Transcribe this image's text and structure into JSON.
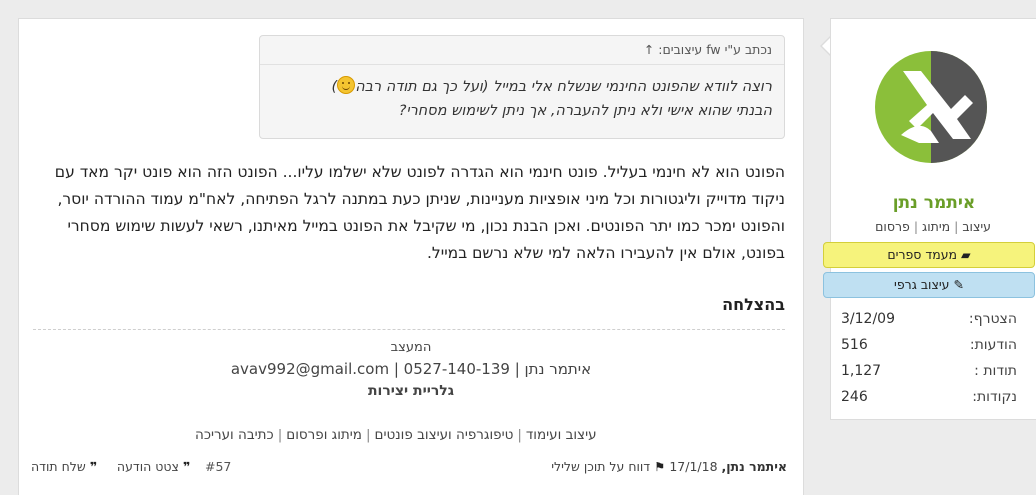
{
  "user": {
    "name": "איתמר נתן",
    "tags": [
      "עיצוב",
      "מיתוג",
      "פרסום"
    ],
    "badges": [
      {
        "label": "מעמד ספרים",
        "icon": "book-icon",
        "color": "#f6f37c"
      },
      {
        "label": "עיצוב גרפי",
        "icon": "pencil-icon",
        "color": "#bfe0f2"
      }
    ],
    "stats": [
      {
        "label": "הצטרף:",
        "value": "3/12/09"
      },
      {
        "label": "הודעות:",
        "value": "516"
      },
      {
        "label": "תודות :",
        "value": "1,127"
      },
      {
        "label": "נקודות:",
        "value": "246"
      }
    ],
    "brand_color": "#6a9e28"
  },
  "quote": {
    "header": "נכתב ע\"י fw עיצובים: ↑",
    "line1": "רוצה לוודא שהפונט החינמי שנשלח אלי במייל (ועל כך גם תודה רבה",
    "line1_end": ")",
    "line2": "הבנתי שהוא אישי ולא ניתן להעברה, אך ניתן לשימוש מסחרי?"
  },
  "message": "הפונט הוא לא חינמי בעליל. פונט חינמי הוא הגדרה לפונט שלא ישלמו עליו... הפונט הזה הוא פונט יקר מאד עם ניקוד מדוייק וליגטורות וכל מיני אופציות מעניינות, שניתן כעת במתנה לרגל הפתיחה, לאח\"מ עמוד ההורדה יוסר, והפונט ימכר כמו יתר הפונטים. ואכן הבנת נכון, מי שקיבל את הפונט במייל מאיתנו, רשאי לעשות שימוש מסחרי בפונט, אולם אין להעבירו הלאה למי שלא נרשם במייל.",
  "greeting": "בהצלחה",
  "signature": {
    "role": "המעצב",
    "contact": "איתמר נתן | avav992@gmail.com | 0527-140-139",
    "gallery": "גלריית יצירות"
  },
  "categories": [
    "עיצוב ועימוד",
    "טיפוגרפיה ועיצוב פונטים",
    "מיתוג ופרסום",
    "כתיבה ועריכה"
  ],
  "footer": {
    "author": "איתמר נתן,",
    "date": "17/1/18",
    "report": "דווח על תוכן שלילי",
    "post_number": "#57",
    "thanks": "שלח תודה",
    "quote_reply": "צטט הודעה"
  }
}
